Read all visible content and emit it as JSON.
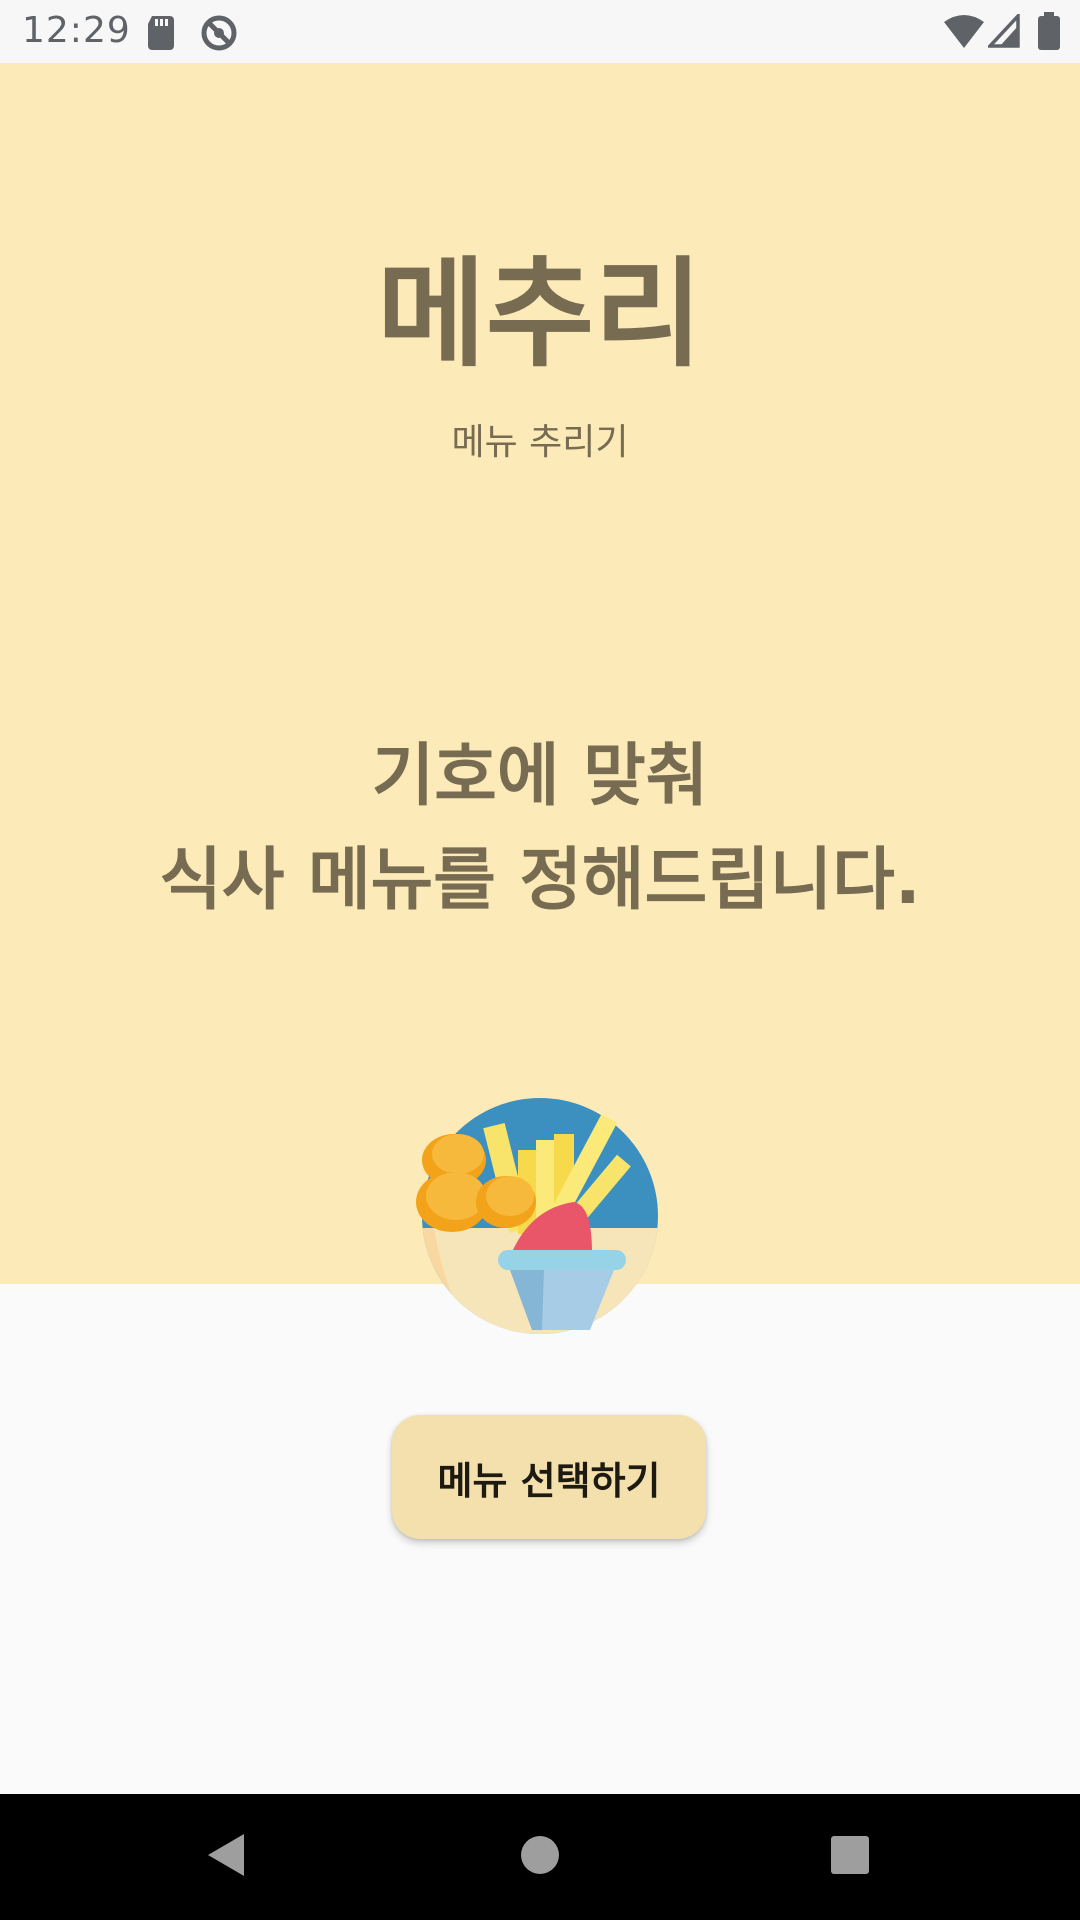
{
  "status_bar": {
    "time": "12:29",
    "icons": [
      "sd-card-icon",
      "sync-off-icon",
      "wifi-icon",
      "signal-icon",
      "battery-icon"
    ]
  },
  "hero": {
    "app_title": "메추리",
    "app_subtitle": "메뉴 추리기",
    "tagline_line1": "기호에 맞춰",
    "tagline_line2": "식사 메뉴를 정해드립니다.",
    "illustration": "fried-chicken-fries-icon"
  },
  "actions": {
    "select_menu_label": "메뉴 선택하기"
  },
  "nav_bar": {
    "icons": [
      "back-icon",
      "home-icon",
      "recents-icon"
    ]
  },
  "colors": {
    "hero_background": "#fcebb8",
    "text_brown": "#776b52",
    "button_background": "#f3e0ac",
    "page_background": "#fafafa"
  }
}
